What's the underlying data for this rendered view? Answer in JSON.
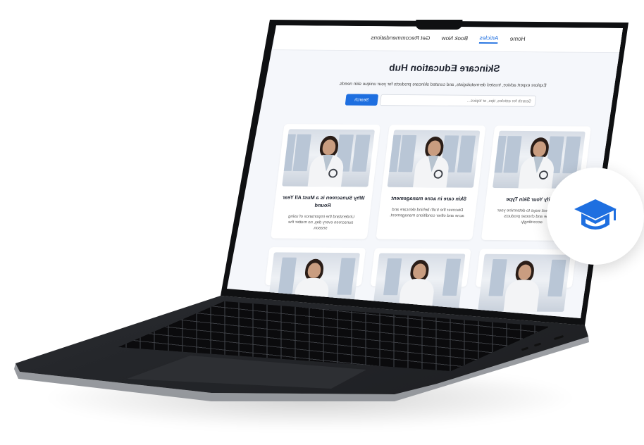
{
  "nav": {
    "items": [
      {
        "label": "Home",
        "active": false
      },
      {
        "label": "Articles",
        "active": true
      },
      {
        "label": "Book Now",
        "active": false
      },
      {
        "label": "Get Recommendations",
        "active": false
      }
    ]
  },
  "hero": {
    "title": "Skincare Education Hub",
    "subtitle": "Explore expert advice, trusted dermatologists, and curated skincare products for your unique skin needs."
  },
  "search": {
    "placeholder": "Search for articles, tips, or topics...",
    "button_label": "Search"
  },
  "articles": [
    {
      "title": "Identify Your Skin Type",
      "description": "Learn the best ways to determine your skin type and choose products accordingly."
    },
    {
      "title": "Skin care in acne management",
      "description": "Discover the truth behind skincare and acne and other conditions management."
    },
    {
      "title": "Why Sunscreen is a Must All Year Round",
      "description": "Understand the importance of using sunscreen every day, no matter the season."
    }
  ],
  "badge": {
    "icon": "graduation-cap-icon",
    "color": "#1e6fe0"
  },
  "colors": {
    "accent": "#1e6fe0",
    "page_bg": "#f5f7fb"
  }
}
